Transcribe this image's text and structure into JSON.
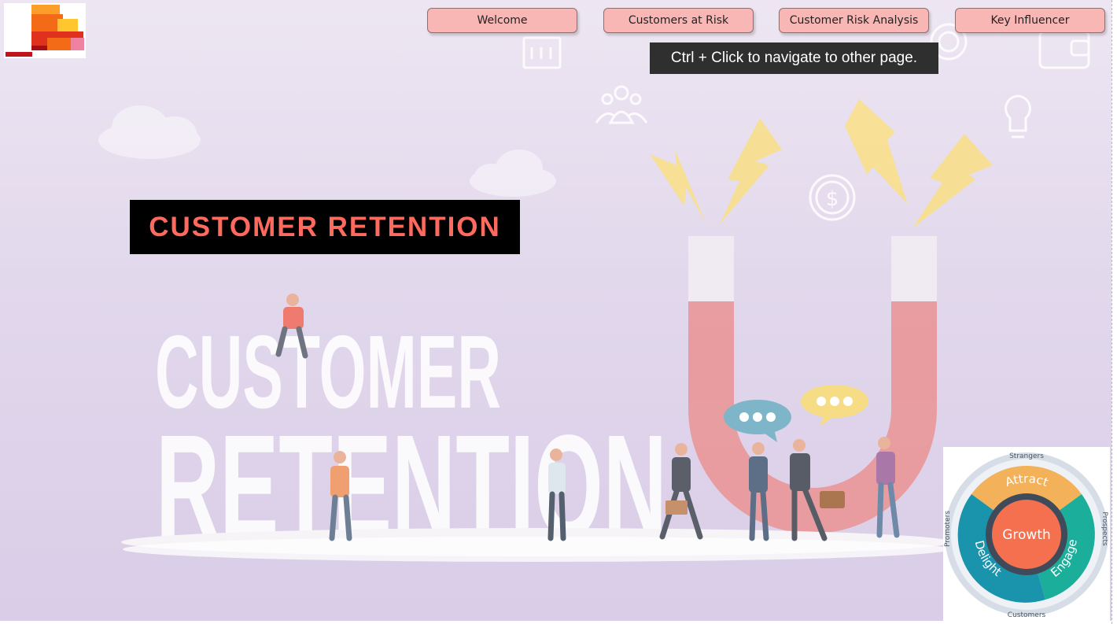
{
  "nav": {
    "buttons": [
      {
        "label": "Welcome"
      },
      {
        "label": "Customers at Risk"
      },
      {
        "label": "Customer Risk Analysis"
      },
      {
        "label": "Key Influencer"
      }
    ],
    "tooltip": "Ctrl + Click to navigate to other page."
  },
  "hero": {
    "title": "CUSTOMER RETENTION",
    "background_word_1": "CUSTOMER",
    "background_word_2": "RETENTION"
  },
  "flywheel": {
    "center": "Growth",
    "segments": [
      "Attract",
      "Engage",
      "Delight"
    ],
    "ring_labels": [
      "Strangers",
      "Prospects",
      "Customers",
      "Promoters"
    ]
  },
  "colors": {
    "button_bg": "#f8b7b5",
    "title_text": "#ff6a5f",
    "tooltip_bg": "#2f2f2f",
    "magnet": "#ea9393",
    "lightning": "#f8e08e",
    "growth": "#f4704f",
    "attract": "#f3b25a",
    "engage": "#1bae9a",
    "delight": "#1a93ad"
  }
}
